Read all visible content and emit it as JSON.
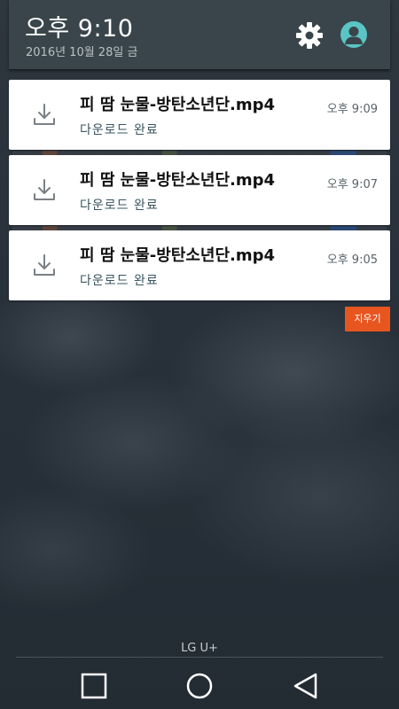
{
  "header": {
    "time": "오후 9:10",
    "date": "2016년 10월 28일 금",
    "settings_icon": "gear-icon",
    "profile_icon": "avatar-icon",
    "avatar_color": "#5bc4c5"
  },
  "notifications": [
    {
      "icon": "download-icon",
      "title": "피 땀 눈물-방탄소년단.mp4",
      "status": "다운로드 완료",
      "time": "오후 9:09"
    },
    {
      "icon": "download-icon",
      "title": "피 땀 눈물-방탄소년단.mp4",
      "status": "다운로드 완료",
      "time": "오후 9:07"
    },
    {
      "icon": "download-icon",
      "title": "피 땀 눈물-방탄소년단.mp4",
      "status": "다운로드 완료",
      "time": "오후 9:05"
    }
  ],
  "clear_button": {
    "label": "지우기",
    "color": "#e8561f"
  },
  "carrier": "LG U+",
  "nav": {
    "recents_icon": "square-icon",
    "home_icon": "circle-icon",
    "back_icon": "triangle-back-icon"
  }
}
